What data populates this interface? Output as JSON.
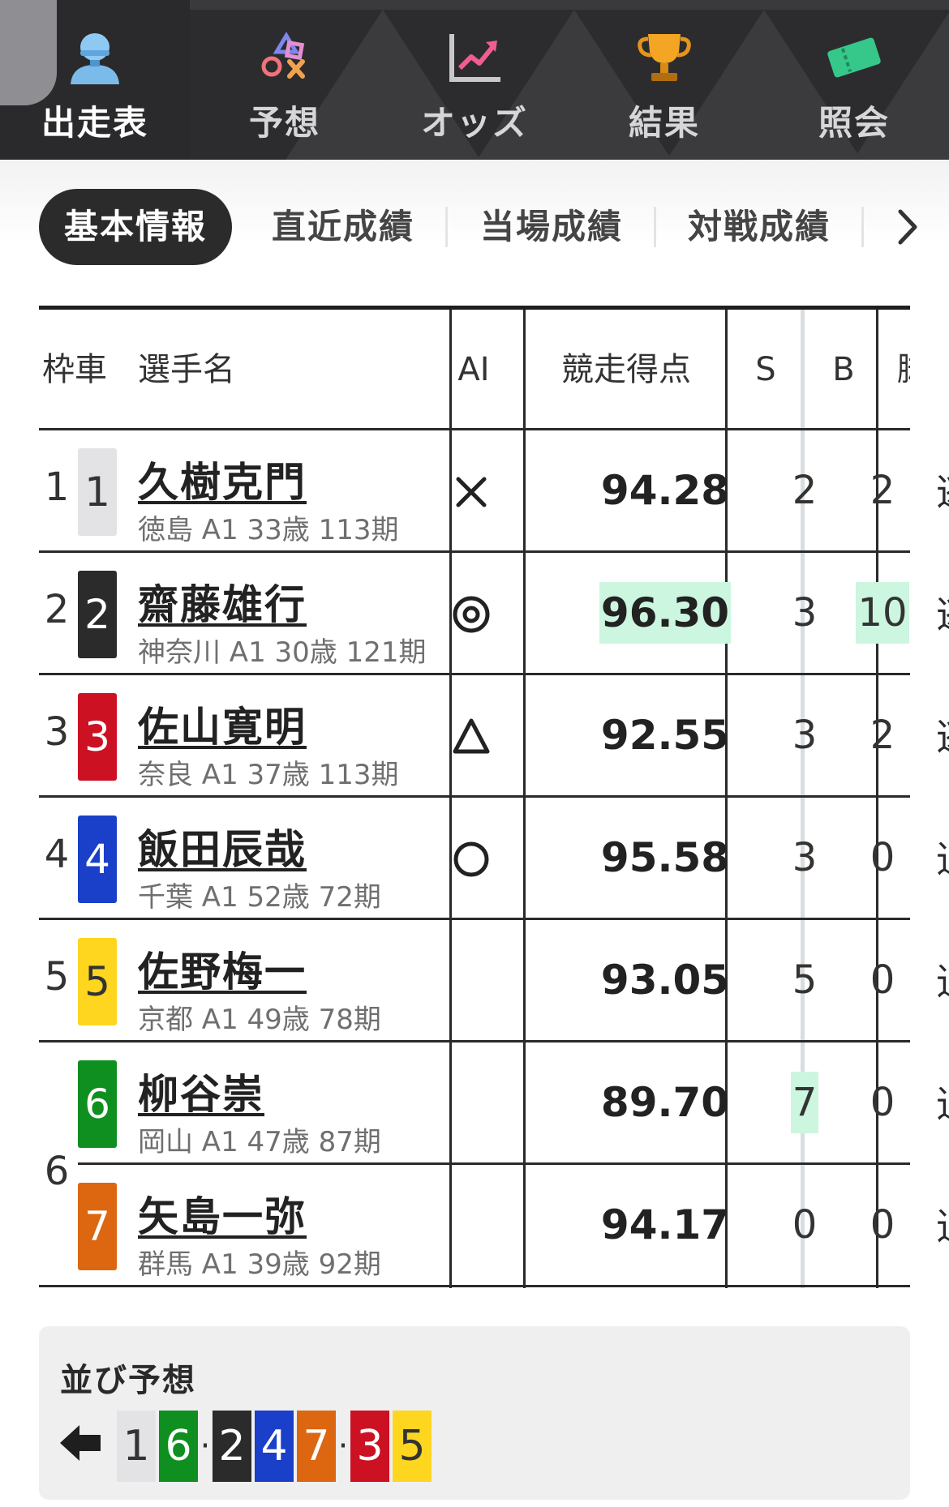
{
  "nav": [
    {
      "label": "出走表",
      "icon": "rider-icon",
      "active": true
    },
    {
      "label": "予想",
      "icon": "playstation-shapes-icon",
      "active": false
    },
    {
      "label": "オッズ",
      "icon": "trend-chart-icon",
      "active": false
    },
    {
      "label": "結果",
      "icon": "trophy-icon",
      "active": false
    },
    {
      "label": "照会",
      "icon": "ticket-icon",
      "active": false
    }
  ],
  "subtabs": {
    "active": "基本情報",
    "items": [
      "直近成績",
      "当場成績",
      "対戦成績"
    ],
    "more_icon": "chevron-right-icon"
  },
  "table": {
    "headers": {
      "frame_car": "枠車",
      "name": "選手名",
      "ai": "AI",
      "score": "競走得点",
      "s": "S",
      "b": "B",
      "cut": "脚"
    },
    "rows": [
      {
        "frame": "1",
        "car": "1",
        "name": "久樹克門",
        "info": "徳島 A1 33歳 113期",
        "ai": "cross",
        "score": "94.28",
        "s": "2",
        "b": "2",
        "cut": "逃"
      },
      {
        "frame": "2",
        "car": "2",
        "name": "齋藤雄行",
        "info": "神奈川 A1 30歳 121期",
        "ai": "double-circle",
        "score": "96.30",
        "s": "3",
        "b": "10",
        "cut": "逃"
      },
      {
        "frame": "3",
        "car": "3",
        "name": "佐山寛明",
        "info": "奈良 A1 37歳 113期",
        "ai": "triangle",
        "score": "92.55",
        "s": "3",
        "b": "2",
        "cut": "逃"
      },
      {
        "frame": "4",
        "car": "4",
        "name": "飯田辰哉",
        "info": "千葉 A1 52歳 72期",
        "ai": "circle",
        "score": "95.58",
        "s": "3",
        "b": "0",
        "cut": "追"
      },
      {
        "frame": "5",
        "car": "5",
        "name": "佐野梅一",
        "info": "京都 A1 49歳 78期",
        "ai": "",
        "score": "93.05",
        "s": "5",
        "b": "0",
        "cut": "追"
      },
      {
        "frame": "6",
        "car": "6",
        "name": "柳谷崇",
        "info": "岡山 A1 47歳 87期",
        "ai": "",
        "score": "89.70",
        "s": "7",
        "b": "0",
        "cut": "追"
      },
      {
        "frame": "",
        "car": "7",
        "name": "矢島一弥",
        "info": "群馬 A1 39歳 92期",
        "ai": "",
        "score": "94.17",
        "s": "0",
        "b": "0",
        "cut": "追"
      }
    ]
  },
  "formation": {
    "title": "並び予想",
    "direction_icon": "arrow-left-icon",
    "cars": [
      "1",
      "6",
      "·",
      "2",
      "4",
      "7",
      "·",
      "3",
      "5"
    ]
  },
  "colors": {
    "car_1": "#e3e3e6",
    "car_2": "#2b2b2b",
    "car_3": "#cc1122",
    "car_4": "#1a3fc8",
    "car_5": "#fed61f",
    "car_6": "#0f8f1f",
    "car_7": "#dd6611",
    "highlight": "#ccf6df"
  }
}
